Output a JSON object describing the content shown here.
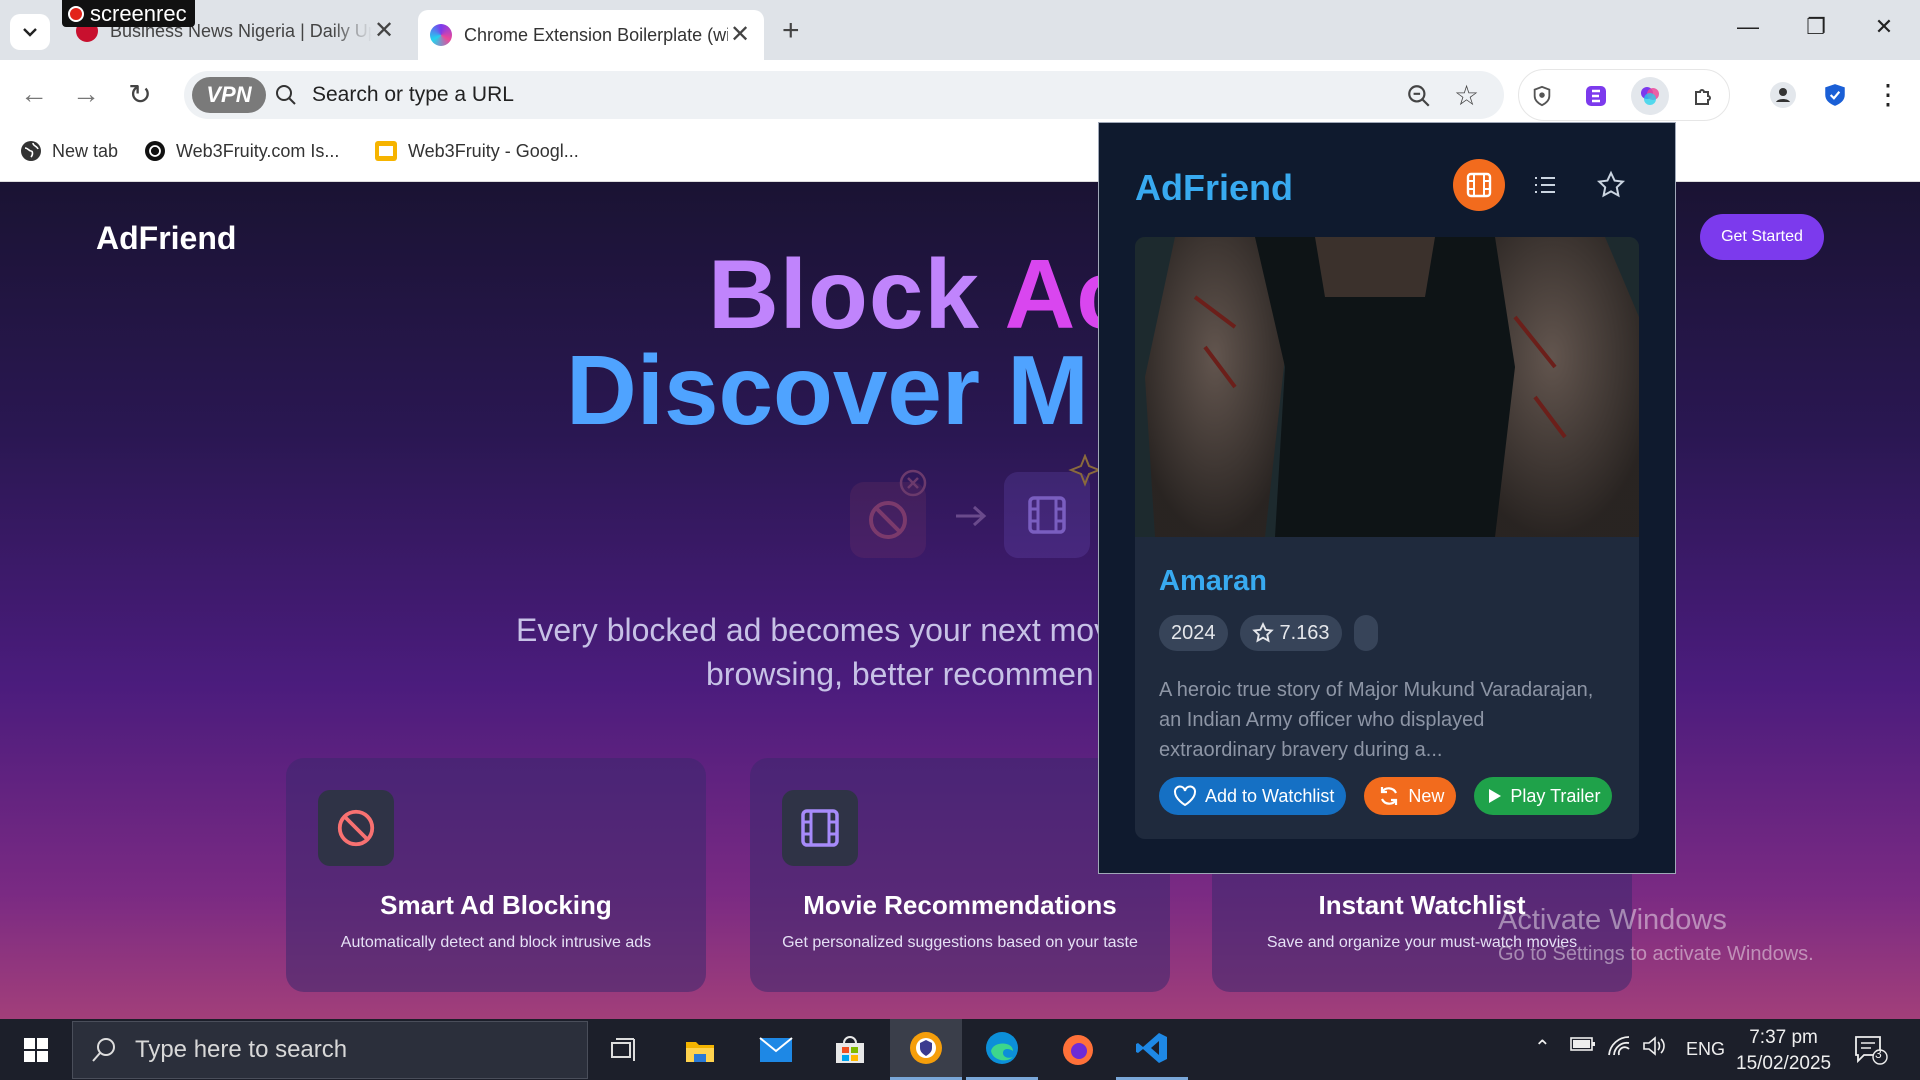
{
  "browser": {
    "recorder_label": "screenrec",
    "tabs": [
      {
        "title": "Business News Nigeria | Daily Update"
      },
      {
        "title": "Chrome Extension Boilerplate (with React)"
      }
    ],
    "address_placeholder": "Search or type a URL",
    "vpn_label": "VPN",
    "bookmarks": [
      {
        "label": "New tab"
      },
      {
        "label": "Web3Fruity.com Is..."
      },
      {
        "label": "Web3Fruity - Googl..."
      }
    ]
  },
  "page": {
    "brand": "AdFriend",
    "cta": "Get Started",
    "hero_line1_a": "Block ",
    "hero_line1_b": "Ac",
    "hero_line2": "Discover M",
    "subtitle_line1": "Every blocked ad becomes your next mov",
    "subtitle_line2": "browsing, better recommen",
    "features": [
      {
        "title": "Smart Ad Blocking",
        "desc": "Automatically detect and block intrusive ads"
      },
      {
        "title": "Movie Recommendations",
        "desc": "Get personalized suggestions based on your taste"
      },
      {
        "title": "Instant Watchlist",
        "desc": "Save and organize your must-watch movies"
      }
    ]
  },
  "popup": {
    "title": "AdFriend",
    "movie": {
      "title": "Amaran",
      "year": "2024",
      "rating": "7.163",
      "overview": "A heroic true story of Major Mukund Varadarajan, an Indian Army officer who displayed extraordinary bravery during a..."
    },
    "actions": {
      "watchlist": "Add to Watchlist",
      "new": "New",
      "trailer": "Play Trailer"
    }
  },
  "windows": {
    "activate_title": "Activate Windows",
    "activate_sub": "Go to Settings to activate Windows.",
    "search_placeholder": "Type here to search",
    "lang": "ENG",
    "time": "7:37 pm",
    "date": "15/02/2025",
    "notifications": "3"
  }
}
